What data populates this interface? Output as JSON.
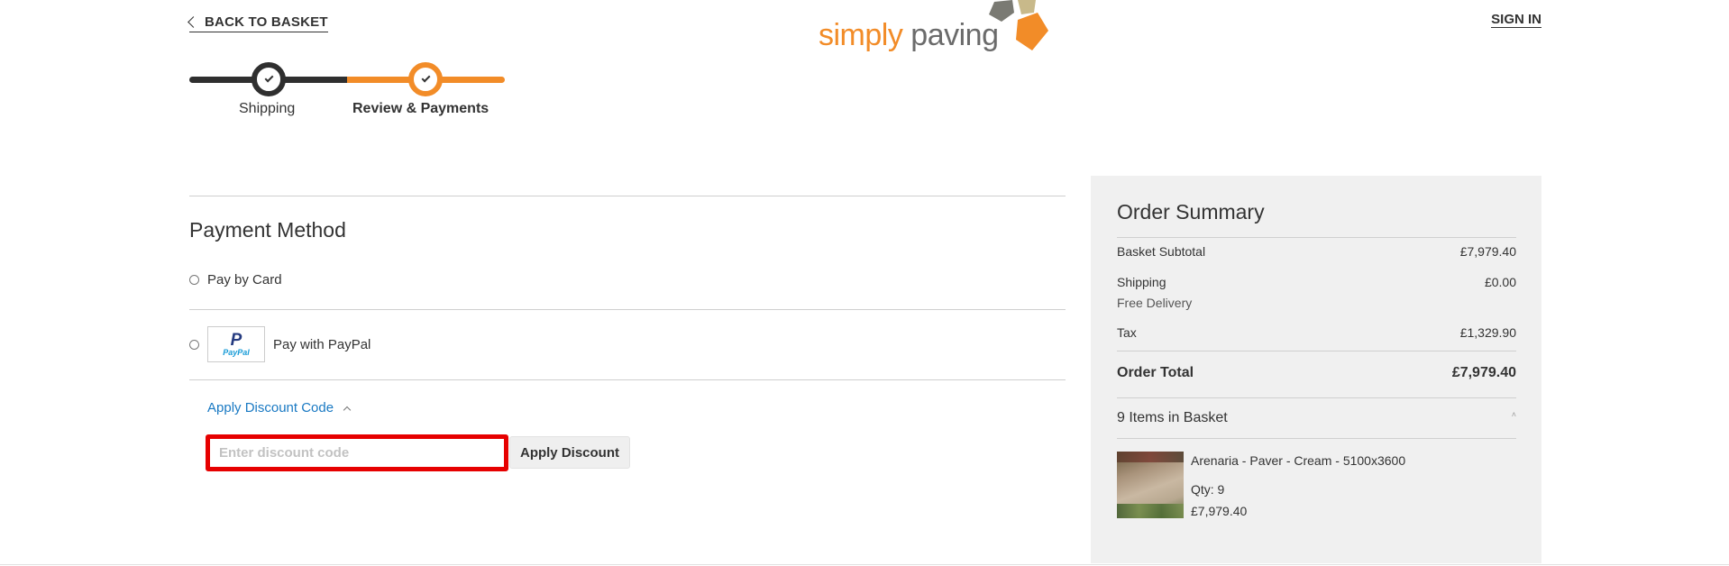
{
  "header": {
    "back_label": "BACK TO BASKET",
    "signin_label": "SIGN IN",
    "logo": {
      "word1": "simply",
      "word2": "paving",
      "colors": {
        "orange": "#f28c28",
        "grey": "#6b6b6b",
        "tan": "#c8b98a"
      }
    }
  },
  "progress": {
    "steps": [
      {
        "label": "Shipping",
        "state": "complete"
      },
      {
        "label": "Review & Payments",
        "state": "current"
      }
    ],
    "colors": {
      "complete": "#2f2f2f",
      "current": "#f28c28"
    }
  },
  "payment": {
    "title": "Payment Method",
    "options": [
      {
        "label": "Pay by Card",
        "selected": false
      },
      {
        "label": "Pay with PayPal",
        "selected": false,
        "logo_text": "PayPal"
      }
    ],
    "discount": {
      "toggle_label": "Apply Discount Code",
      "input_value": "",
      "input_placeholder": "Enter discount code",
      "button_label": "Apply Discount",
      "highlight_color": "#e60000"
    }
  },
  "summary": {
    "title": "Order Summary",
    "rows": {
      "subtotal": {
        "label": "Basket Subtotal",
        "value": "£7,979.40"
      },
      "shipping": {
        "label": "Shipping",
        "value": "£0.00",
        "note": "Free Delivery"
      },
      "tax": {
        "label": "Tax",
        "value": "£1,329.90"
      },
      "total": {
        "label": "Order Total",
        "value": "£7,979.40"
      }
    },
    "items_heading": "9 Items in Basket",
    "items_caret": "˄",
    "items": [
      {
        "name": "Arenaria - Paver - Cream - 5100x3600",
        "qty_label": "Qty: 9",
        "price": "£7,979.40"
      }
    ]
  },
  "link_color": "#1979c3"
}
